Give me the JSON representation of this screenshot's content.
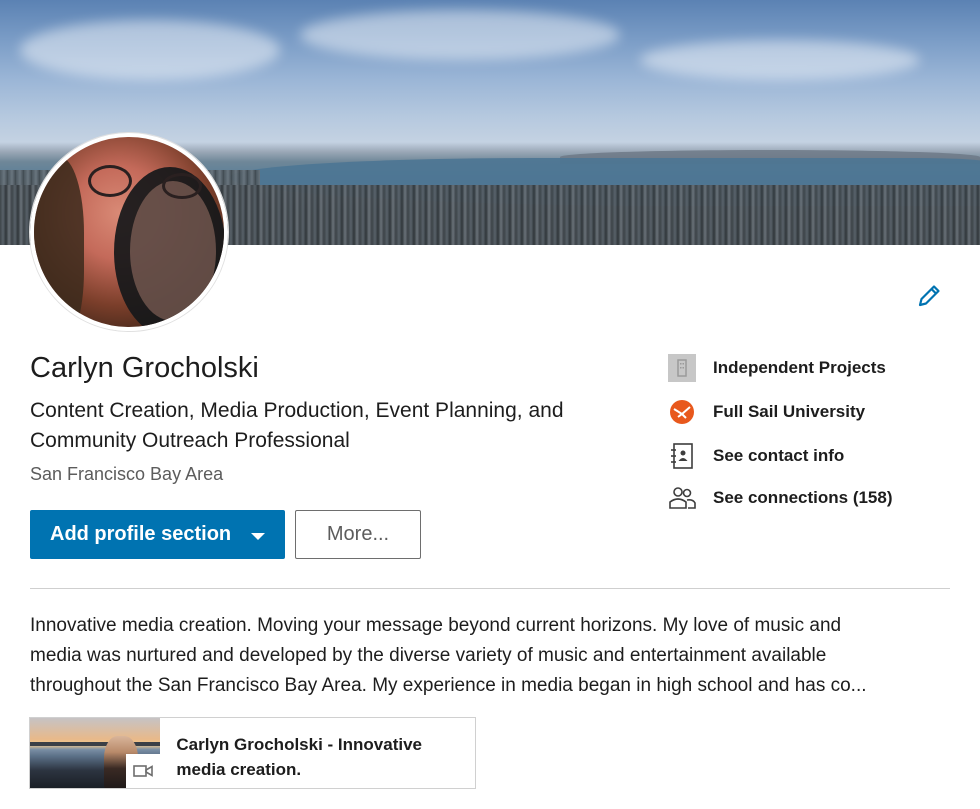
{
  "profile": {
    "name": "Carlyn Grocholski",
    "headline": "Content Creation, Media Production, Event Planning, and Community Outreach Professional",
    "location": "San Francisco Bay Area"
  },
  "actions": {
    "primary_label": "Add profile section",
    "secondary_label": "More..."
  },
  "sidebar": {
    "items": [
      {
        "label": "Independent Projects",
        "icon": "building-icon"
      },
      {
        "label": "Full Sail University",
        "icon": "school-logo-icon"
      },
      {
        "label": "See contact info",
        "icon": "contact-book-icon"
      },
      {
        "label": "See connections (158)",
        "icon": "people-icon"
      }
    ]
  },
  "summary": {
    "lines": [
      "Innovative media creation. Moving your message beyond current horizons. My love of music and",
      "media was nurtured and developed by the diverse variety of music and entertainment available",
      "throughout the San Francisco Bay Area. My experience in media began in high school and has co..."
    ]
  },
  "media": {
    "title": "Carlyn Grocholski - Innovative media creation.",
    "badge_icon": "video-icon"
  },
  "colors": {
    "accent": "#0073b1",
    "text": "#1d1d1d",
    "muted": "#5c5c5c",
    "school_orange": "#e8581c"
  }
}
